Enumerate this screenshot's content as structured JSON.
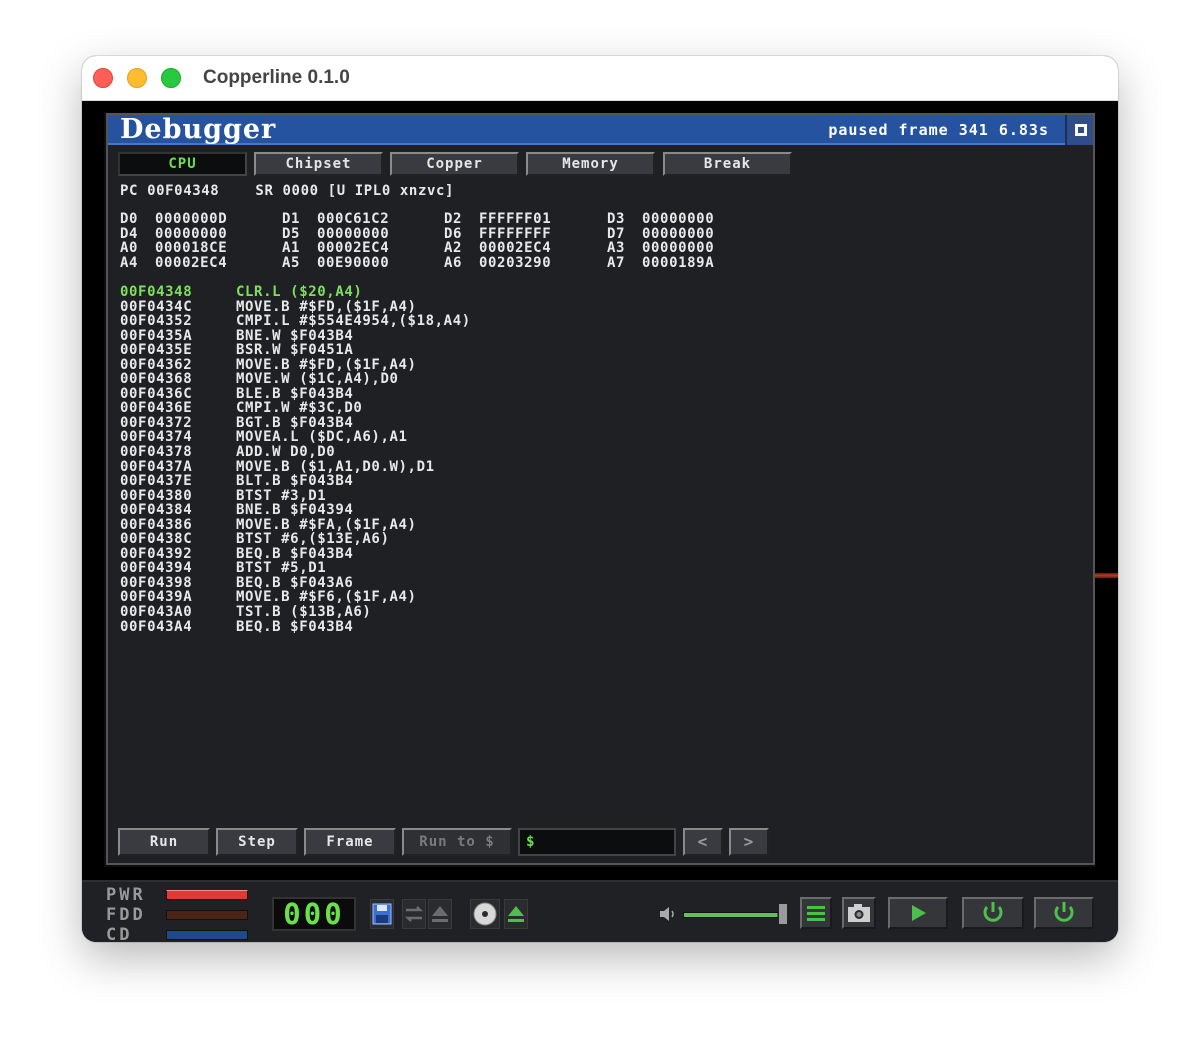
{
  "window": {
    "title": "Copperline 0.1.0"
  },
  "debugger": {
    "title": "Debugger",
    "status": "paused frame 341 6.83s",
    "tabs": [
      {
        "label": "CPU",
        "active": true
      },
      {
        "label": "Chipset",
        "active": false
      },
      {
        "label": "Copper",
        "active": false
      },
      {
        "label": "Memory",
        "active": false
      },
      {
        "label": "Break",
        "active": false
      }
    ],
    "pc_line": "PC 00F04348    SR 0000 [U IPL0 xnzvc]",
    "registers": [
      [
        "D0",
        "0000000D",
        "D1",
        "000C61C2",
        "D2",
        "FFFFFF01",
        "D3",
        "00000000"
      ],
      [
        "D4",
        "00000000",
        "D5",
        "00000000",
        "D6",
        "FFFFFFFF",
        "D7",
        "00000000"
      ],
      [
        "A0",
        "000018CE",
        "A1",
        "00002EC4",
        "A2",
        "00002EC4",
        "A3",
        "00000000"
      ],
      [
        "A4",
        "00002EC4",
        "A5",
        "00E90000",
        "A6",
        "00203290",
        "A7",
        "0000189A"
      ]
    ],
    "disassembly": [
      {
        "addr": "00F04348",
        "ins": "CLR.L ($20,A4)",
        "current": true
      },
      {
        "addr": "00F0434C",
        "ins": "MOVE.B #$FD,($1F,A4)"
      },
      {
        "addr": "00F04352",
        "ins": "CMPI.L #$554E4954,($18,A4)"
      },
      {
        "addr": "00F0435A",
        "ins": "BNE.W $F043B4"
      },
      {
        "addr": "00F0435E",
        "ins": "BSR.W $F0451A"
      },
      {
        "addr": "00F04362",
        "ins": "MOVE.B #$FD,($1F,A4)"
      },
      {
        "addr": "00F04368",
        "ins": "MOVE.W ($1C,A4),D0"
      },
      {
        "addr": "00F0436C",
        "ins": "BLE.B $F043B4"
      },
      {
        "addr": "00F0436E",
        "ins": "CMPI.W #$3C,D0"
      },
      {
        "addr": "00F04372",
        "ins": "BGT.B $F043B4"
      },
      {
        "addr": "00F04374",
        "ins": "MOVEA.L ($DC,A6),A1"
      },
      {
        "addr": "00F04378",
        "ins": "ADD.W D0,D0"
      },
      {
        "addr": "00F0437A",
        "ins": "MOVE.B ($1,A1,D0.W),D1"
      },
      {
        "addr": "00F0437E",
        "ins": "BLT.B $F043B4"
      },
      {
        "addr": "00F04380",
        "ins": "BTST #3,D1"
      },
      {
        "addr": "00F04384",
        "ins": "BNE.B $F04394"
      },
      {
        "addr": "00F04386",
        "ins": "MOVE.B #$FA,($1F,A4)"
      },
      {
        "addr": "00F0438C",
        "ins": "BTST #6,($13E,A6)"
      },
      {
        "addr": "00F04392",
        "ins": "BEQ.B $F043B4"
      },
      {
        "addr": "00F04394",
        "ins": "BTST #5,D1"
      },
      {
        "addr": "00F04398",
        "ins": "BEQ.B $F043A6"
      },
      {
        "addr": "00F0439A",
        "ins": "MOVE.B #$F6,($1F,A4)"
      },
      {
        "addr": "00F043A0",
        "ins": "TST.B ($13B,A6)"
      },
      {
        "addr": "00F043A4",
        "ins": "BEQ.B $F043B4"
      }
    ],
    "controls": {
      "run": "Run",
      "step": "Step",
      "frame": "Frame",
      "run_to": "Run to $",
      "address_value": "$",
      "prev": "<",
      "next": ">"
    }
  },
  "statusbar": {
    "leds": [
      {
        "label": "PWR",
        "color": "#e03a36"
      },
      {
        "label": "FDD",
        "color": "#4a2515"
      },
      {
        "label": "CD",
        "color": "#1e4a8a"
      }
    ],
    "counter": "000",
    "volume": 0.95,
    "icons": [
      "floppy-icon",
      "swap-icon",
      "eject-icon",
      "cd-icon",
      "cd-eject-icon",
      "speaker-icon",
      "menu-icon",
      "camera-icon",
      "play-icon",
      "power-icon",
      "power-reset-icon"
    ]
  },
  "colors": {
    "accent_green": "#6ae04c",
    "header_blue": "#2653a0",
    "power_red": "#e03a36"
  }
}
